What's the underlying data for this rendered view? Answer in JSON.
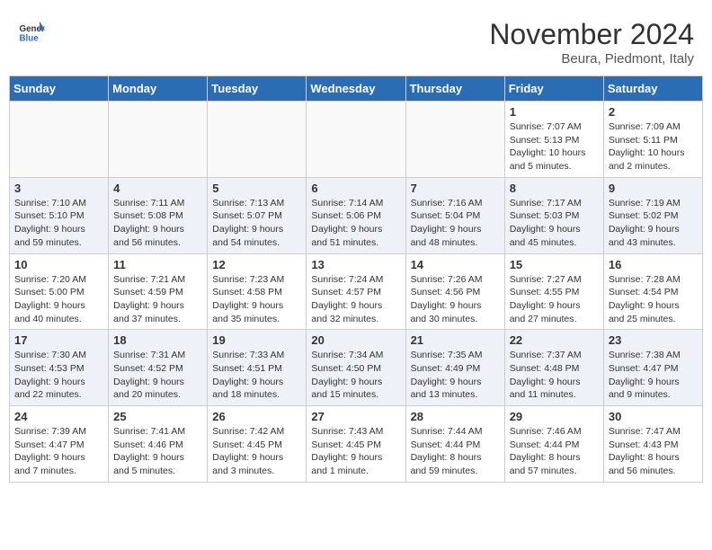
{
  "header": {
    "logo_general": "General",
    "logo_blue": "Blue",
    "month_title": "November 2024",
    "location": "Beura, Piedmont, Italy"
  },
  "weekdays": [
    "Sunday",
    "Monday",
    "Tuesday",
    "Wednesday",
    "Thursday",
    "Friday",
    "Saturday"
  ],
  "weeks": [
    [
      {
        "day": "",
        "info": ""
      },
      {
        "day": "",
        "info": ""
      },
      {
        "day": "",
        "info": ""
      },
      {
        "day": "",
        "info": ""
      },
      {
        "day": "",
        "info": ""
      },
      {
        "day": "1",
        "info": "Sunrise: 7:07 AM\nSunset: 5:13 PM\nDaylight: 10 hours and 5 minutes."
      },
      {
        "day": "2",
        "info": "Sunrise: 7:09 AM\nSunset: 5:11 PM\nDaylight: 10 hours and 2 minutes."
      }
    ],
    [
      {
        "day": "3",
        "info": "Sunrise: 7:10 AM\nSunset: 5:10 PM\nDaylight: 9 hours and 59 minutes."
      },
      {
        "day": "4",
        "info": "Sunrise: 7:11 AM\nSunset: 5:08 PM\nDaylight: 9 hours and 56 minutes."
      },
      {
        "day": "5",
        "info": "Sunrise: 7:13 AM\nSunset: 5:07 PM\nDaylight: 9 hours and 54 minutes."
      },
      {
        "day": "6",
        "info": "Sunrise: 7:14 AM\nSunset: 5:06 PM\nDaylight: 9 hours and 51 minutes."
      },
      {
        "day": "7",
        "info": "Sunrise: 7:16 AM\nSunset: 5:04 PM\nDaylight: 9 hours and 48 minutes."
      },
      {
        "day": "8",
        "info": "Sunrise: 7:17 AM\nSunset: 5:03 PM\nDaylight: 9 hours and 45 minutes."
      },
      {
        "day": "9",
        "info": "Sunrise: 7:19 AM\nSunset: 5:02 PM\nDaylight: 9 hours and 43 minutes."
      }
    ],
    [
      {
        "day": "10",
        "info": "Sunrise: 7:20 AM\nSunset: 5:00 PM\nDaylight: 9 hours and 40 minutes."
      },
      {
        "day": "11",
        "info": "Sunrise: 7:21 AM\nSunset: 4:59 PM\nDaylight: 9 hours and 37 minutes."
      },
      {
        "day": "12",
        "info": "Sunrise: 7:23 AM\nSunset: 4:58 PM\nDaylight: 9 hours and 35 minutes."
      },
      {
        "day": "13",
        "info": "Sunrise: 7:24 AM\nSunset: 4:57 PM\nDaylight: 9 hours and 32 minutes."
      },
      {
        "day": "14",
        "info": "Sunrise: 7:26 AM\nSunset: 4:56 PM\nDaylight: 9 hours and 30 minutes."
      },
      {
        "day": "15",
        "info": "Sunrise: 7:27 AM\nSunset: 4:55 PM\nDaylight: 9 hours and 27 minutes."
      },
      {
        "day": "16",
        "info": "Sunrise: 7:28 AM\nSunset: 4:54 PM\nDaylight: 9 hours and 25 minutes."
      }
    ],
    [
      {
        "day": "17",
        "info": "Sunrise: 7:30 AM\nSunset: 4:53 PM\nDaylight: 9 hours and 22 minutes."
      },
      {
        "day": "18",
        "info": "Sunrise: 7:31 AM\nSunset: 4:52 PM\nDaylight: 9 hours and 20 minutes."
      },
      {
        "day": "19",
        "info": "Sunrise: 7:33 AM\nSunset: 4:51 PM\nDaylight: 9 hours and 18 minutes."
      },
      {
        "day": "20",
        "info": "Sunrise: 7:34 AM\nSunset: 4:50 PM\nDaylight: 9 hours and 15 minutes."
      },
      {
        "day": "21",
        "info": "Sunrise: 7:35 AM\nSunset: 4:49 PM\nDaylight: 9 hours and 13 minutes."
      },
      {
        "day": "22",
        "info": "Sunrise: 7:37 AM\nSunset: 4:48 PM\nDaylight: 9 hours and 11 minutes."
      },
      {
        "day": "23",
        "info": "Sunrise: 7:38 AM\nSunset: 4:47 PM\nDaylight: 9 hours and 9 minutes."
      }
    ],
    [
      {
        "day": "24",
        "info": "Sunrise: 7:39 AM\nSunset: 4:47 PM\nDaylight: 9 hours and 7 minutes."
      },
      {
        "day": "25",
        "info": "Sunrise: 7:41 AM\nSunset: 4:46 PM\nDaylight: 9 hours and 5 minutes."
      },
      {
        "day": "26",
        "info": "Sunrise: 7:42 AM\nSunset: 4:45 PM\nDaylight: 9 hours and 3 minutes."
      },
      {
        "day": "27",
        "info": "Sunrise: 7:43 AM\nSunset: 4:45 PM\nDaylight: 9 hours and 1 minute."
      },
      {
        "day": "28",
        "info": "Sunrise: 7:44 AM\nSunset: 4:44 PM\nDaylight: 8 hours and 59 minutes."
      },
      {
        "day": "29",
        "info": "Sunrise: 7:46 AM\nSunset: 4:44 PM\nDaylight: 8 hours and 57 minutes."
      },
      {
        "day": "30",
        "info": "Sunrise: 7:47 AM\nSunset: 4:43 PM\nDaylight: 8 hours and 56 minutes."
      }
    ]
  ]
}
